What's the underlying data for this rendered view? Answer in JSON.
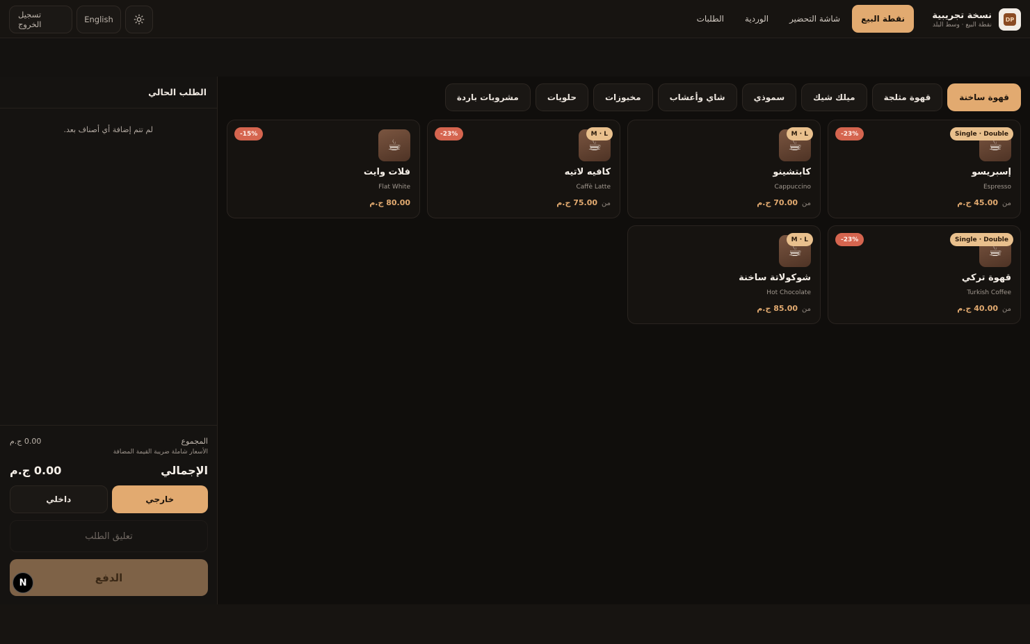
{
  "header": {
    "brand_title": "نسخة تجريبية",
    "brand_subtitle": "نقطة البيع · وسط البلد",
    "brand_logo": "DP",
    "nav": [
      {
        "label": "نقطة البيع",
        "active": true
      },
      {
        "label": "شاشة التحضير",
        "active": false
      },
      {
        "label": "الوردية",
        "active": false
      },
      {
        "label": "الطلبات",
        "active": false
      }
    ],
    "logout_label": "تسجيل الخروج",
    "language_label": "English",
    "theme_icon": "sun-icon"
  },
  "order": {
    "title": "الطلب الحالي",
    "empty_text": "لم تتم إضافة أي أصناف بعد.",
    "subtotal_label": "المجموع",
    "subtotal_value": "0.00 ج.م",
    "vat_note": "الأسعار شاملة ضريبة القيمة المضافة",
    "total_label": "الإجمالي",
    "total_value": "0.00 ج.م",
    "type_takeaway": "خارجي",
    "type_dinein": "داخلي",
    "note_placeholder": "تعليق الطلب",
    "pay_label": "الدفع",
    "badge_letter": "N"
  },
  "categories": [
    {
      "label": "قهوة ساخنة",
      "active": true
    },
    {
      "label": "قهوة مثلجة",
      "active": false
    },
    {
      "label": "ميلك شيك",
      "active": false
    },
    {
      "label": "سموذي",
      "active": false
    },
    {
      "label": "شاي وأعشاب",
      "active": false
    },
    {
      "label": "مخبوزات",
      "active": false
    },
    {
      "label": "حلويات",
      "active": false
    },
    {
      "label": "مشروبات باردة",
      "active": false
    }
  ],
  "products": [
    {
      "name": "إسبريسو",
      "name_en": "Espresso",
      "sizes": "Single · Double",
      "discount": "-23%",
      "from": "من",
      "price": "45.00 ج.م"
    },
    {
      "name": "كابتشينو",
      "name_en": "Cappuccino",
      "sizes": "M · L",
      "discount": "",
      "from": "من",
      "price": "70.00 ج.م"
    },
    {
      "name": "كافيه لاتيه",
      "name_en": "Caffè Latte",
      "sizes": "M · L",
      "discount": "-23%",
      "from": "من",
      "price": "75.00 ج.م"
    },
    {
      "name": "فلات وايت",
      "name_en": "Flat White",
      "sizes": "",
      "discount": "-15%",
      "from": "",
      "price": "80.00 ج.م"
    },
    {
      "name": "قهوة تركي",
      "name_en": "Turkish Coffee",
      "sizes": "Single · Double",
      "discount": "-23%",
      "from": "من",
      "price": "40.00 ج.م"
    },
    {
      "name": "شوكولاتة ساخنة",
      "name_en": "Hot Chocolate",
      "sizes": "M · L",
      "discount": "",
      "from": "من",
      "price": "85.00 ج.م"
    }
  ],
  "colors": {
    "accent": "#e2aa70",
    "discount": "#d5654f",
    "size_badge": "#e9c08d"
  }
}
